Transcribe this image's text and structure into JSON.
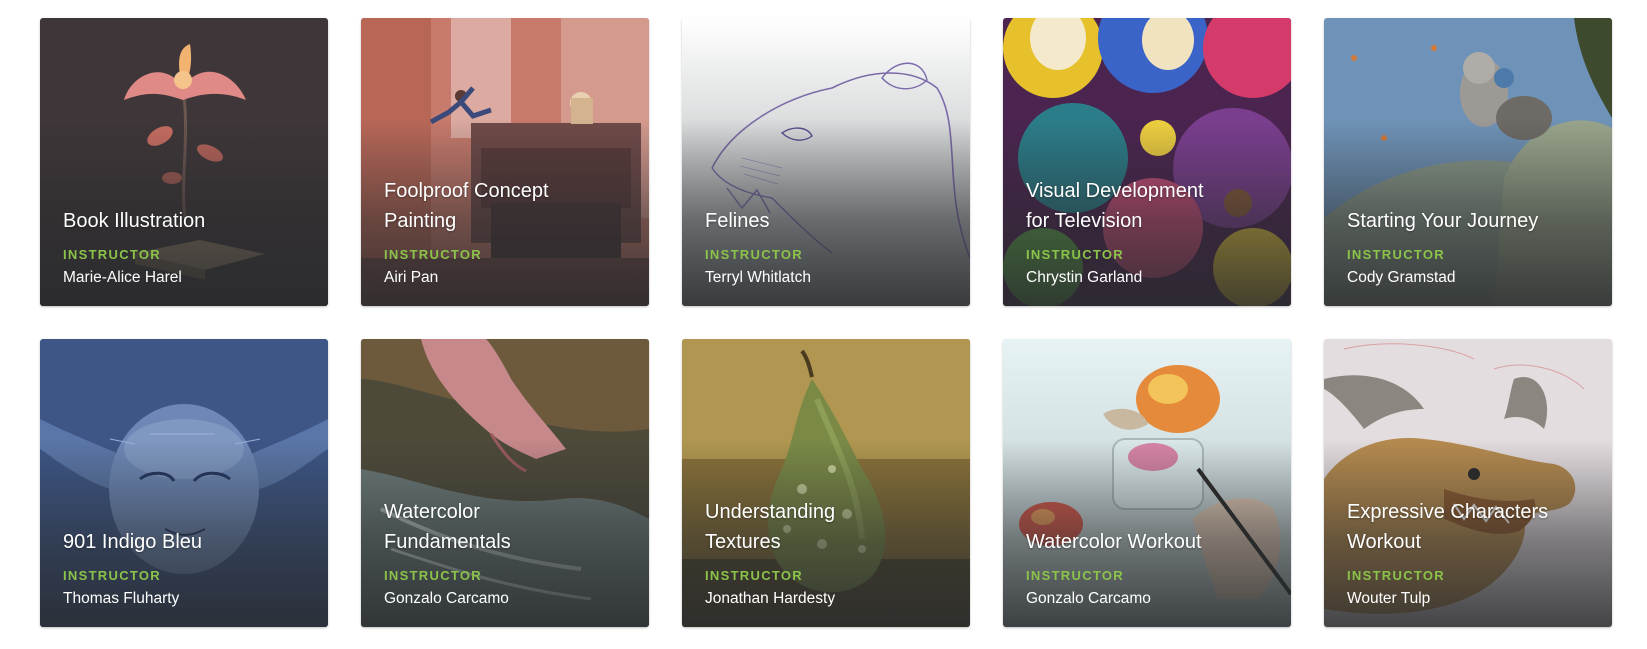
{
  "courses": [
    {
      "title_lines": [
        "Book Illustration"
      ],
      "role": "INSTRUCTOR",
      "instructor": "Marie-Alice Harel",
      "art": "flower-on-book"
    },
    {
      "title_lines": [
        "Foolproof Concept",
        "Painting"
      ],
      "role": "INSTRUCTOR",
      "instructor": "Airi Pan",
      "art": "street-truck-jump"
    },
    {
      "title_lines": [
        "Felines"
      ],
      "role": "INSTRUCTOR",
      "instructor": "Terryl Whitlatch",
      "art": "lion-sketch"
    },
    {
      "title_lines": [
        "Visual Development",
        "for Television"
      ],
      "role": "INSTRUCTOR",
      "instructor": "Chrystin Garland",
      "art": "colorful-masks"
    },
    {
      "title_lines": [
        "Starting Your Journey"
      ],
      "role": "INSTRUCTOR",
      "instructor": "Cody Gramstad",
      "art": "raccoon-traveler"
    },
    {
      "title_lines": [
        "901 Indigo Bleu"
      ],
      "role": "INSTRUCTOR",
      "instructor": "Thomas Fluharty",
      "art": "blue-portrait"
    },
    {
      "title_lines": [
        "Watercolor",
        "Fundamentals"
      ],
      "role": "INSTRUCTOR",
      "instructor": "Gonzalo Carcamo",
      "art": "foot-in-water"
    },
    {
      "title_lines": [
        "Understanding",
        "Textures"
      ],
      "role": "INSTRUCTOR",
      "instructor": "Jonathan Hardesty",
      "art": "pear-still-life"
    },
    {
      "title_lines": [
        "Watercolor Workout"
      ],
      "role": "INSTRUCTOR",
      "instructor": "Gonzalo Carcamo",
      "art": "watercolor-fruit"
    },
    {
      "title_lines": [
        "Expressive Characters",
        "Workout"
      ],
      "role": "INSTRUCTOR",
      "instructor": "Wouter Tulp",
      "art": "goat-character-sketch"
    }
  ]
}
